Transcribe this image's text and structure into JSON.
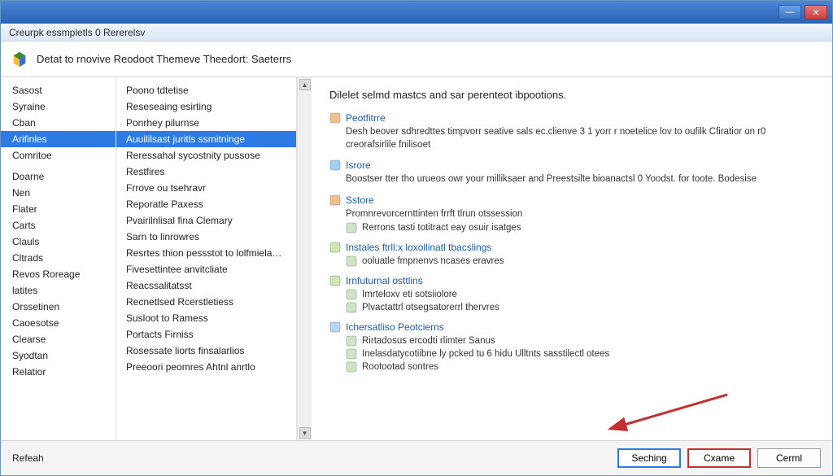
{
  "titlebar": {
    "text": "Creurpk essmpletls 0 Rererelsv"
  },
  "banner": {
    "title": "Detat to rnovive Reodoot Themeve Theedort: Saeterrs"
  },
  "left_categories": [
    "Sasost",
    "Syraine",
    "Cban",
    "Arifinles",
    "Comritoe",
    "",
    "Doarne",
    "Nen",
    "Flater",
    "Carts",
    "Clauls",
    "Cltrads",
    "Revos Roreage",
    "latites",
    "Orssetinen",
    "Caoesotse",
    "Clearse",
    "Syodtan",
    "Relatior"
  ],
  "left_selected_index": 3,
  "mid_options": [
    "Poono tdtetise",
    "Reseseaing esirting",
    "Ponrhey pilurnse",
    "Auuililsast juritls ssmitninge",
    "Reressahal sycostnity pussose",
    "Restfires",
    "Frrove ou tsehravr",
    "Reporatle Paxess",
    "Pvairilnlisal fina Clemary",
    "Sarn to linrowres",
    "Resrtes thion pessstot to lolfmielahes",
    "Fivesettintee anvitcliate",
    "Reacssalitatsst",
    "Recnetlsed Rcerstletiess",
    "Susloot to Ramess",
    "Portacts Firniss",
    "Rosessate liorts finsalarlios",
    "Preeoori peomres Ahtnl anrtlo"
  ],
  "mid_selected_index": 3,
  "right": {
    "heading": "Dilelet selmd mastcs and sar perenteot ibpootions.",
    "sections": [
      {
        "title": "Peotfitrre",
        "desc": "Desh beover sdhredttes timpvorr seative sals ec.clienve 3 1 yorr r noetelice lov to oufilk Cfiratior on r0 creorafsirlile fnilisoet",
        "subs": []
      },
      {
        "title": "Isrore",
        "desc": "Boostser tter tho urueos owr your milliksaer and Preestsilte bioanactsl 0 Yoodst. for toote. Bodesise",
        "subs": []
      },
      {
        "title": "Sstore",
        "desc": "Promnrevorcernttinten frrft tlrun otssession",
        "subs": [
          "Rerrons tasti totitract eay osuir isatges"
        ]
      },
      {
        "title": "Instales ftrll:x loxollinatl tbacslings",
        "desc": "",
        "subs": [
          "ooluatle fmpnenvs ncases eravres"
        ]
      },
      {
        "title": "Irnfuturnal osttlins",
        "desc": "",
        "subs": [
          "Imrteloxv eti sotsiiolore",
          "Plvactattrl otsegsatorerrl thervres"
        ]
      },
      {
        "title": "Ichersatliso Peotcierns",
        "desc": "",
        "subs": [
          "Rirtadosus ercodti rlimter Sanus",
          "Inelasdatycotiibne ly pcked tu 6 hidu Ulltnts sasstilectl otees",
          "Rootootad sontres"
        ]
      }
    ]
  },
  "footer": {
    "refresh": "Refeah",
    "btn1": "Seching",
    "btn2": "Cxame",
    "btn3": "Cerml"
  }
}
